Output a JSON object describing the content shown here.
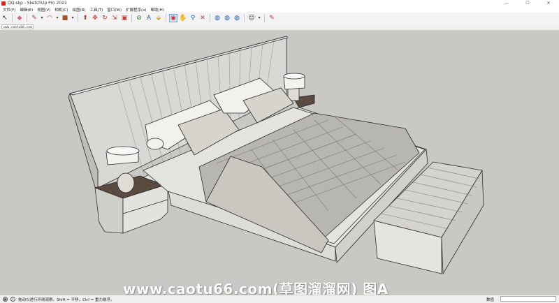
{
  "window": {
    "title": "QQ.skp - SketchUp Pro 2021",
    "controls": [
      "—",
      "☐",
      "✕"
    ]
  },
  "menu": [
    "文件(F)",
    "编辑(E)",
    "视图(V)",
    "相机(C)",
    "绘图(R)",
    "工具(T)",
    "窗口(W)",
    "扩展程序(x)",
    "帮助(H)"
  ],
  "toolbar": {
    "tools": [
      {
        "name": "select-icon",
        "glyph": "↖",
        "color": "#222222"
      },
      {
        "name": "eraser-icon",
        "glyph": "◆",
        "color": "#e0608a"
      },
      {
        "name": "pencil-icon",
        "glyph": "✎",
        "color": "#c0392b"
      },
      {
        "name": "arc-icon",
        "glyph": "◠",
        "color": "#c0392b"
      },
      {
        "name": "rectangle-icon",
        "glyph": "■",
        "color": "#a0522d"
      },
      {
        "name": "pushpull-icon",
        "glyph": "⬆",
        "color": "#c0392b"
      },
      {
        "name": "move-icon",
        "glyph": "✥",
        "color": "#c0392b"
      },
      {
        "name": "rotate-icon",
        "glyph": "↻",
        "color": "#c0392b"
      },
      {
        "name": "scale-icon",
        "glyph": "⇲",
        "color": "#c0392b"
      },
      {
        "name": "offset-icon",
        "glyph": "▣",
        "color": "#c0392b"
      },
      {
        "name": "tape-measure-icon",
        "glyph": "⊘",
        "color": "#2e7d32"
      },
      {
        "name": "text-label-icon",
        "glyph": "A",
        "color": "#1a5fb4"
      },
      {
        "name": "paint-bucket-icon",
        "glyph": "⬙",
        "color": "#d4a017"
      },
      {
        "name": "orbit-icon",
        "glyph": "◉",
        "color": "#c0392b"
      },
      {
        "name": "pan-icon",
        "glyph": "✋",
        "color": "#333333"
      },
      {
        "name": "zoom-icon",
        "glyph": "⚲",
        "color": "#1a5fb4"
      },
      {
        "name": "zoom-extents-icon",
        "glyph": "✕",
        "color": "#c0392b"
      },
      {
        "name": "warehouse-icon",
        "glyph": "◍",
        "color": "#1a5fb4"
      },
      {
        "name": "extension-icon",
        "glyph": "◍",
        "color": "#1a5fb4"
      },
      {
        "name": "layout-icon",
        "glyph": "◍",
        "color": "#1a5fb4"
      },
      {
        "name": "account-icon",
        "glyph": "☺",
        "color": "#333333"
      },
      {
        "name": "style-builder-icon",
        "glyph": "✎",
        "color": "#c0392b"
      }
    ]
  },
  "tab": {
    "label": "www.caotu66.com"
  },
  "viewport": {
    "background": "#c8c9c4"
  },
  "watermark": {
    "text": "www.caotu66.com(草图溜溜网) 图A"
  },
  "status": {
    "hint": "拖动以进行环绕观察。Shift = 平移，Ctrl = 重力悬浮。",
    "measurement_label": "数值",
    "measurement_value": ""
  }
}
